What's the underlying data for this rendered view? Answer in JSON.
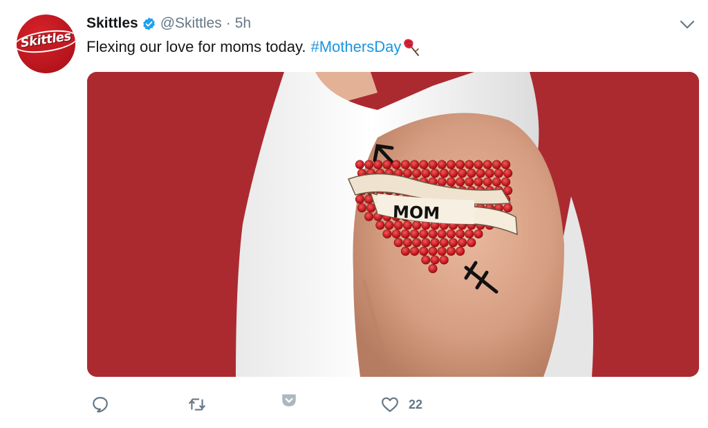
{
  "tweet": {
    "author_name": "Skittles",
    "handle": "@Skittles",
    "separator": "·",
    "time": "5h",
    "text": "Flexing our love for moms today.",
    "hashtag": "#MothersDay",
    "avatar_text": "Skittles",
    "image_banner_text": "MOM",
    "likes": "22"
  },
  "colors": {
    "link": "#1b95e0",
    "verified": "#1da1f2",
    "muted": "#657786",
    "image_background": "#ab2a30"
  }
}
